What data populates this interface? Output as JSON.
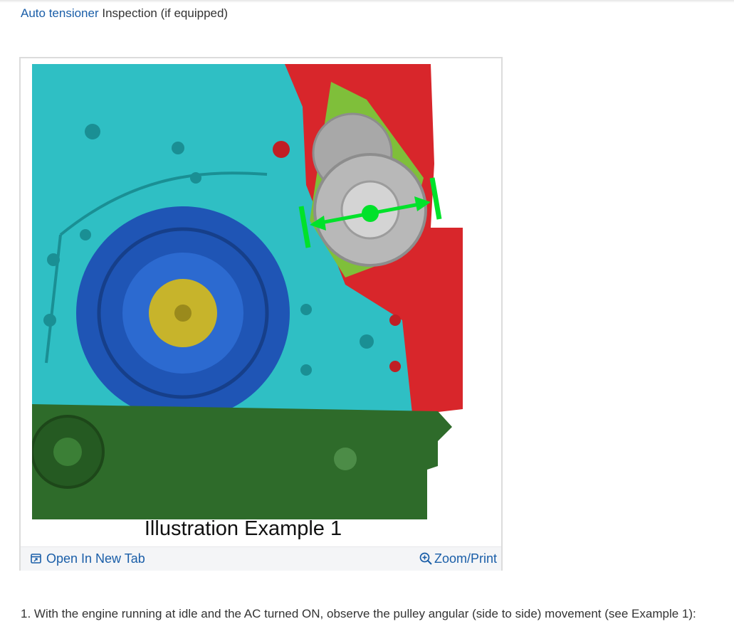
{
  "heading": {
    "link_text": "Auto tensioner",
    "rest_text": " Inspection (if equipped)"
  },
  "figure": {
    "caption": "Illustration Example 1",
    "open_label": "Open In New Tab",
    "zoom_label": "Zoom/Print",
    "icons": {
      "open": "open-in-new-tab-icon",
      "zoom": "zoom-in-icon"
    }
  },
  "step": {
    "text": "1. With the engine running at idle and the AC turned ON, observe the pulley angular (side to side) movement (see Example 1):"
  },
  "colors": {
    "link": "#1a5ea8",
    "engine_block": "#2fbfc4",
    "engine_red": "#d8262b",
    "oil_pan": "#2e6b2a",
    "damper": "#1f55b5",
    "hub": "#c7b42b",
    "tensioner": "#b8b8b8",
    "indicator": "#00e22a"
  }
}
